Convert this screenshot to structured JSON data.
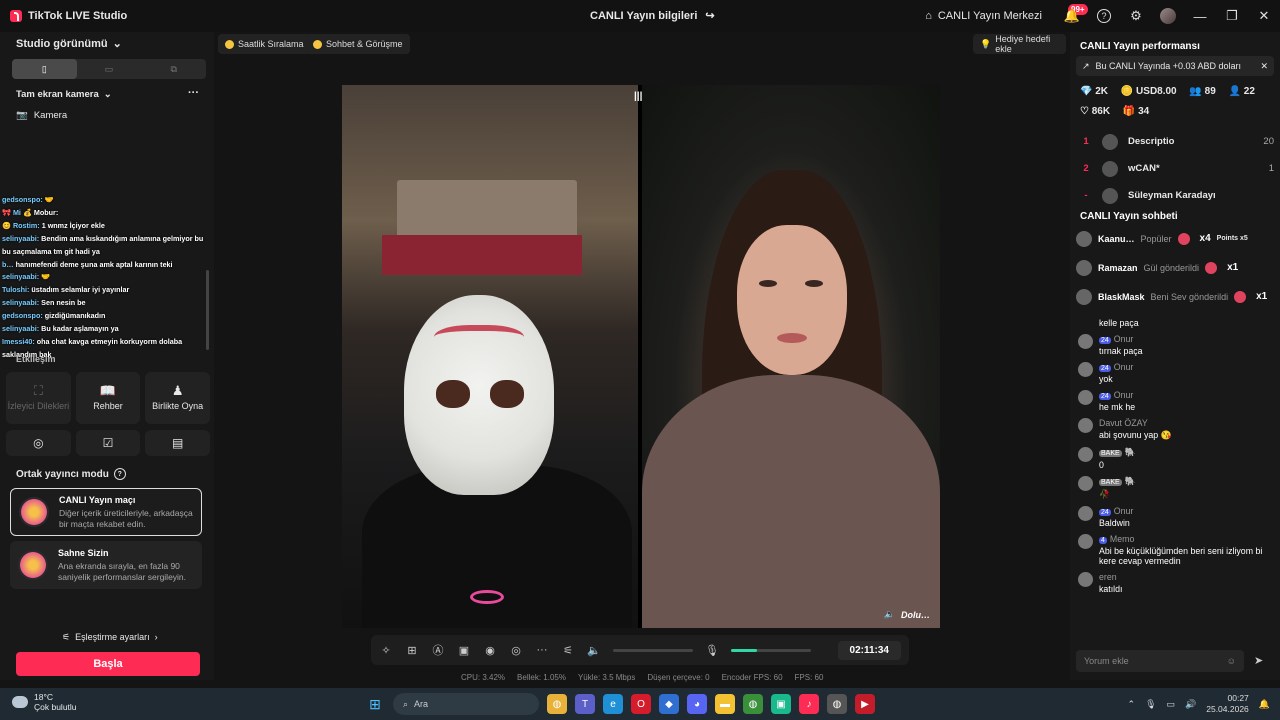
{
  "titlebar": {
    "app_name": "TikTok LIVE Studio",
    "center_title": "CANLI Yayın bilgileri",
    "live_center": "CANLI Yayın Merkezi",
    "notif_badge": "99+"
  },
  "left": {
    "studio_view": "Studio görünümü",
    "fullscreen_camera": "Tam ekran kamera",
    "camera_label": "Kamera",
    "chat_overlay": [
      {
        "user": "gedsonspo:",
        "text": "🤝"
      },
      {
        "user": "🎀 Mi",
        "text": "💰 Mobur:"
      },
      {
        "user": "😊 Rostim:",
        "text": "1 wnmz İçiyor ekle"
      },
      {
        "user": "selinyaabi:",
        "text": "Bendim ama kıskandığım anlamına gelmiyor bu bu saçmalama tm git hadi ya"
      },
      {
        "user": "b…",
        "text": "hanımefendi deme şuna amk aptal karının teki"
      },
      {
        "user": "selinyaabi:",
        "text": "🤝"
      },
      {
        "user": "Tuloshi:",
        "text": "üstadım selamlar iyi yayınlar"
      },
      {
        "user": "selinyaabi:",
        "text": "Sen nesin be"
      },
      {
        "user": "gedsonspo:",
        "text": "gizdiğümanıkadın"
      },
      {
        "user": "selinyaabi:",
        "text": "Bu kadar aşlamayın ya"
      },
      {
        "user": "Imessi40:",
        "text": "oha chat kavga etmeyin korkuyorm dolaba saklandım bak"
      }
    ],
    "interaction_title": "Etkileşim",
    "tiles": [
      {
        "label": "İzleyici Dilekleri",
        "icon": "viewer-wishes-icon"
      },
      {
        "label": "Rehber",
        "icon": "guide-icon"
      },
      {
        "label": "Birlikte Oyna",
        "icon": "play-together-icon"
      }
    ],
    "cohost_mode": "Ortak yayıncı modu",
    "cards": [
      {
        "title": "CANLI Yayın maçı",
        "desc": "Diğer içerik üreticileriyle, arkadaşça bir maçta rekabet edin."
      },
      {
        "title": "Sahne Sizin",
        "desc": "Ana ekranda sırayla, en fazla 90 saniyelik performanslar sergileyin."
      }
    ],
    "match_settings": "Eşleştirme ayarları",
    "start_button": "Başla"
  },
  "center": {
    "pill1": "Saatlik Sıralama",
    "pill2": "Sohbet & Görüşme",
    "gift_goal": "Hediye hedefi ekle",
    "stream_tag": "Dolu…",
    "timer": "02:11:34",
    "stats": [
      "CPU: 3.42%",
      "Bellek: 1.05%",
      "Yükle: 3.5 Mbps",
      "Düşen çerçeve: 0",
      "Encoder FPS: 60",
      "FPS: 60"
    ]
  },
  "right": {
    "perf_title": "CANLI Yayın performansı",
    "earnings": "Bu CANLI Yayında +0.03 ABD doları",
    "metrics": {
      "diamonds": "2K",
      "usd": "USD8.00",
      "viewers": "89",
      "followers": "22",
      "likes": "86K",
      "gifts": "34"
    },
    "ranking": [
      {
        "num": "1",
        "name": "Descriptio",
        "count": "20"
      },
      {
        "num": "2",
        "name": "wCAN*",
        "count": "1"
      },
      {
        "num": "-",
        "name": "Süleyman Karadayı",
        "count": ""
      }
    ],
    "chat_title": "CANLI Yayın sohbeti",
    "gifts": [
      {
        "user": "Kaanu…",
        "msg": "Popüler",
        "x": "x4",
        "extra": "Points x5"
      },
      {
        "user": "Ramazan",
        "msg": "Gül gönderildi",
        "x": "x1",
        "extra": ""
      },
      {
        "user": "BlaskMask",
        "msg": "Beni Sev gönderildi",
        "x": "x1",
        "extra": ""
      }
    ],
    "messages": [
      {
        "level": "",
        "name": "",
        "text": "kelle paça"
      },
      {
        "level": "24",
        "name": "Onur",
        "text": "tırnak paça"
      },
      {
        "level": "24",
        "name": "Onur",
        "text": "yok"
      },
      {
        "level": "24",
        "name": "Onur",
        "text": "he mk he"
      },
      {
        "level": "",
        "name": "Davut ÖZAY",
        "text": "abi şovunu yap 😘"
      },
      {
        "level": "BAKE",
        "name": "🐘",
        "text": "0"
      },
      {
        "level": "BAKE",
        "name": "🐘",
        "text": "🥀"
      },
      {
        "level": "24",
        "name": "Onur",
        "text": "Baldwin"
      },
      {
        "level": "4",
        "name": "Memo",
        "text": "Abi be küçüklüğümden beri seni izliyom bi kere cevap vermedin"
      },
      {
        "level": "",
        "name": "eren",
        "text": "katıldı"
      }
    ],
    "comment_placeholder": "Yorum ekle"
  },
  "taskbar": {
    "temp": "18°C",
    "weather": "Çok bulutlu",
    "search": "Ara",
    "time": "00:27",
    "date": "25.04.2026"
  }
}
